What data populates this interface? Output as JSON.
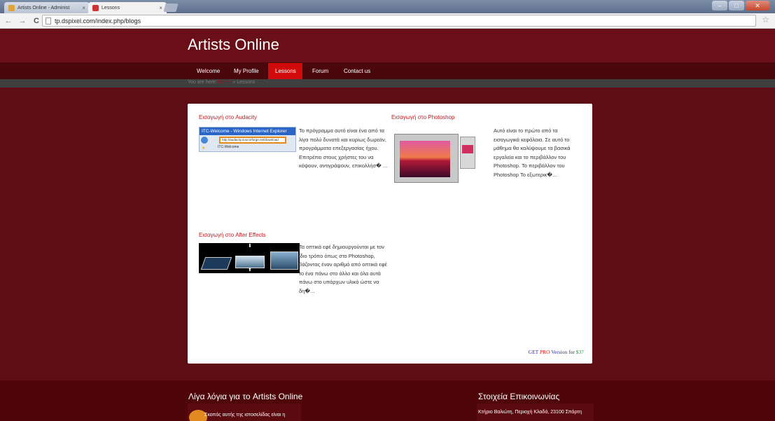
{
  "browser": {
    "tabs": [
      {
        "title": "Artists Online - Administ"
      },
      {
        "title": "Lessons"
      }
    ],
    "url": "tp.dspixel.com/index.php/blogs",
    "window_controls": [
      "–",
      "□",
      "✕"
    ]
  },
  "site": {
    "title": "Artists Online",
    "nav": [
      "Welcome",
      "My Profile",
      "Lessons",
      "Forum",
      "Contact us"
    ],
    "active_nav": "Lessons",
    "breadcrumb": {
      "prefix": "You are here:",
      "home": "Home",
      "sep": "»",
      "current": "Lessons"
    }
  },
  "posts": [
    {
      "title": "Εισαγωγή στο Audacity",
      "text": "Το πρόγραμμα αυτό είναι ένα από τα λίγα πολύ δυνατά και κυρίως δωρεάν, προγράμματα επεξεργασίας ήχου. Επιτρέπει στους χρήστες του να κόψουν, αντιγράψουν, επικολλήσ� ...",
      "thumb_caption": "ITC-Welcome - Windows Internet Explorer",
      "thumb_url": "http://audacity.sourceforge.net/download",
      "thumb_tab": "ITC-Welcome"
    },
    {
      "title": "Εισαγωγή στο Photoshop",
      "text": "Αυτό είναι το πρώτο από τα εισαγωγικά κεφάλαια. Σε αυτό το μάθημα θα καλύψουμε τα βασικά εργαλεία και το περιβάλλον του Photoshop. Το περιβάλλον του Photoshop Το εξωτερικ�..."
    },
    {
      "title": "Εισαγωγή στο After Effects",
      "text": "Τα οπτικά εφέ δημιουργούνται με τον ίδιο τρόπο όπως στο Photoshop, βάζοντας έναν αριθμό από οπτικά εφέ το ένα πάνω στο άλλο και όλα αυτά πάνω στο υπάρχων υλικό ώστε να δη�..."
    }
  ],
  "pro_banner": {
    "get": "GET",
    "pro": "PRO",
    "version": "Version",
    "for": "for",
    "price": "$37"
  },
  "footer": {
    "about_heading": "Λίγα λόγια για το Artists Online",
    "about_text": "Σκοπός αυτής της ιστοσελίδας είναι η",
    "contact_heading": "Στοιχεία Επικοινωνίας",
    "contact_text": "Κτήριο Βαλιώτη, Περιοχή Κλαδά, 23100 Σπάρτη"
  }
}
